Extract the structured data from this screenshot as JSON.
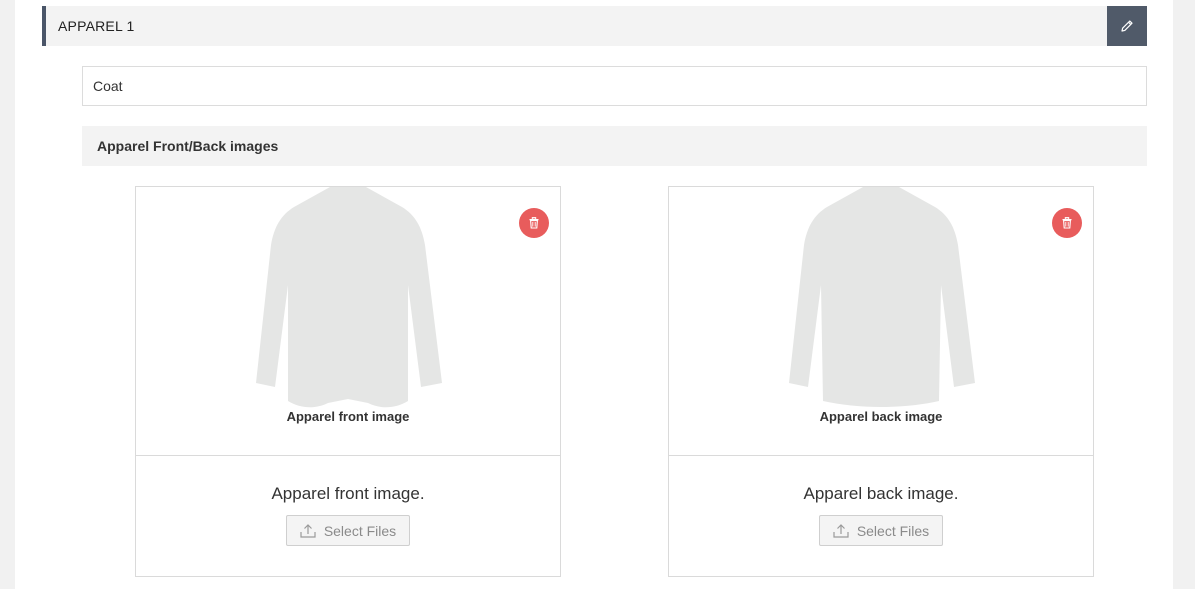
{
  "header": {
    "title": "APPAREL 1",
    "edit_icon": "pencil-icon"
  },
  "apparel_name": {
    "value": "Coat"
  },
  "images_section": {
    "title": "Apparel Front/Back images"
  },
  "cards": [
    {
      "id": "front",
      "image_caption": "Apparel front image",
      "upload_title": "Apparel front image.",
      "select_label": "Select Files",
      "delete_icon": "trash-icon",
      "upload_icon": "upload-icon"
    },
    {
      "id": "back",
      "image_caption": "Apparel back image",
      "upload_title": "Apparel back image.",
      "select_label": "Select Files",
      "delete_icon": "trash-icon",
      "upload_icon": "upload-icon"
    }
  ],
  "colors": {
    "header_accent": "#4a5568",
    "edit_button": "#505a69",
    "delete_button": "#e85c5c",
    "garment": "#e5e6e5"
  }
}
